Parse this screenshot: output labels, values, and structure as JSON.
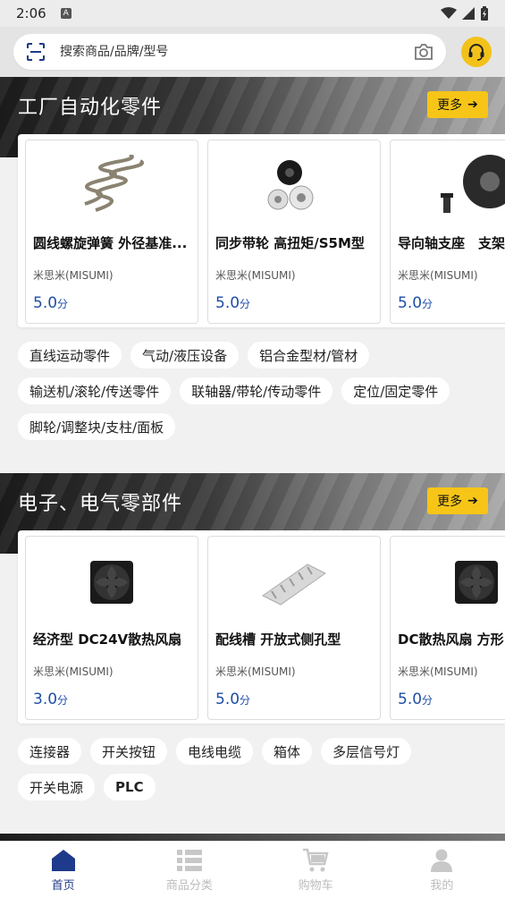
{
  "status": {
    "time": "2:06"
  },
  "search": {
    "placeholder": "搜索商品/品牌/型号"
  },
  "sections": [
    {
      "title": "工厂自动化零件",
      "more": "更多",
      "products": [
        {
          "name": "圆线螺旋弹簧 外径基准...",
          "brand": "米思米(MISUMI)",
          "score": "5.0",
          "unit": "分",
          "icon": "spring-image"
        },
        {
          "name": "同步带轮 高扭矩/S5M型",
          "brand": "米思米(MISUMI)",
          "score": "5.0",
          "unit": "分",
          "icon": "pulley-image"
        },
        {
          "name": "导向轴支座　支架",
          "brand": "米思米(MISUMI)",
          "score": "5.0",
          "unit": "分",
          "icon": "shaft-holder-image"
        }
      ],
      "tags": [
        "直线运动零件",
        "气动/液压设备",
        "铝合金型材/管材",
        "输送机/滚轮/传送零件",
        "联轴器/带轮/传动零件",
        "定位/固定零件",
        "脚轮/调整块/支柱/面板"
      ]
    },
    {
      "title": "电子、电气零部件",
      "more": "更多",
      "products": [
        {
          "name": "经济型 DC24V散热风扇",
          "brand": "米思米(MISUMI)",
          "score": "3.0",
          "unit": "分",
          "icon": "fan-image"
        },
        {
          "name": "配线槽 开放式侧孔型",
          "brand": "米思米(MISUMI)",
          "score": "5.0",
          "unit": "分",
          "icon": "wiring-duct-image"
        },
        {
          "name": "DC散热风扇 方形",
          "brand": "米思米(MISUMI)",
          "score": "5.0",
          "unit": "分",
          "icon": "fan-image"
        }
      ],
      "tags": [
        "连接器",
        "开关按钮",
        "电线电缆",
        "箱体",
        "多层信号灯",
        "开关电源",
        "PLC"
      ]
    }
  ],
  "nav": [
    {
      "label": "首页",
      "icon": "home-icon",
      "active": true
    },
    {
      "label": "商品分类",
      "icon": "category-icon",
      "active": false
    },
    {
      "label": "购物车",
      "icon": "cart-icon",
      "active": false
    },
    {
      "label": "我的",
      "icon": "profile-icon",
      "active": false
    }
  ],
  "colors": {
    "accent": "#f6c517",
    "brand_blue": "#1e3a8a",
    "price_blue": "#1e4ea8"
  }
}
